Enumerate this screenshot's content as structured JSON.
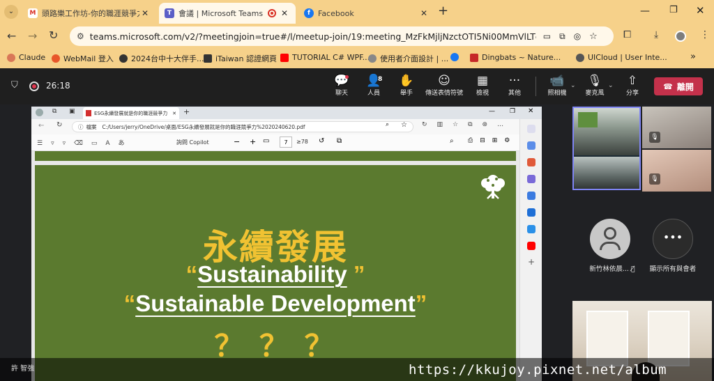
{
  "browser": {
    "tabs": [
      {
        "title": "頭路樂工作坊-你的職涯競爭力：",
        "favicon": "gmail-icon"
      },
      {
        "title": "會議 | Microsoft Teams",
        "favicon": "teams-icon",
        "active": true
      },
      {
        "title": "Facebook",
        "favicon": "facebook-icon"
      }
    ],
    "new_tab": "+",
    "url": "teams.microsoft.com/v2/?meetingjoin=true#/l/meetup-join/19:meeting_MzFkMjljNzctOTI5Ni00MmVlLTg1NjQtYTdi...",
    "bookmarks": [
      {
        "label": "Claude",
        "color": "#d97757"
      },
      {
        "label": "WebMail 登入",
        "color": "#e8562a"
      },
      {
        "label": "2024台中十大伴手...",
        "color": "#333333"
      },
      {
        "label": "iTaiwan 認證網頁",
        "color": "#333333"
      },
      {
        "label": "TUTORIAL C# WPF...",
        "color": "#ff0000"
      },
      {
        "label": "使用者介面設計 | ...",
        "color": "#888888"
      },
      {
        "label": "",
        "color": "#1877f2"
      },
      {
        "label": "Dingbats ~ Nature...",
        "color": "#c62828"
      },
      {
        "label": "UICloud | User Inte...",
        "color": "#555555"
      }
    ],
    "more": "»"
  },
  "meeting": {
    "timer": "26:18",
    "controls": [
      {
        "label": "聊天",
        "icon": "chat-icon",
        "glyph": "💬"
      },
      {
        "label": "人員",
        "icon": "people-icon",
        "glyph": "👤",
        "badge": "8"
      },
      {
        "label": "舉手",
        "icon": "raise-hand-icon",
        "glyph": "✋"
      },
      {
        "label": "傳送表情符號",
        "icon": "emoji-icon",
        "glyph": "☺"
      },
      {
        "label": "檢視",
        "icon": "view-icon",
        "glyph": "▦"
      },
      {
        "label": "其他",
        "icon": "more-icon",
        "glyph": "···"
      },
      {
        "label": "照相機",
        "icon": "camera-icon",
        "glyph": "📹"
      },
      {
        "label": "麥克風",
        "icon": "microphone-icon",
        "glyph": "🎙"
      },
      {
        "label": "分享",
        "icon": "share-icon",
        "glyph": "⇧"
      }
    ],
    "leave": "離開"
  },
  "pdf_window": {
    "tab_title": "ESG永續發展就是你的職涯競爭力",
    "address_label": "檔案",
    "path": "C:/Users/jerry/OneDrive/桌面/ESG永續發展就是你的職涯競爭力%2020240620.pdf",
    "copilot": "詢問 Copilot",
    "page_current": "7",
    "page_total": "78",
    "zoom_minus": "−",
    "zoom_plus": "+"
  },
  "slide": {
    "title_zh": "永續發展",
    "term1": "Sustainability",
    "term2": "Sustainable Development",
    "questions": "？ ？ ？",
    "quote_open": "“",
    "quote_close": "”"
  },
  "participants": {
    "named": [
      {
        "name": "新竹林依晨...",
        "muted": true
      },
      {
        "name": "顯示所有與會者",
        "muted": false
      }
    ]
  },
  "caption": {
    "speaker": "許 智強"
  },
  "watermark": "https://kkujoy.pixnet.net/album"
}
